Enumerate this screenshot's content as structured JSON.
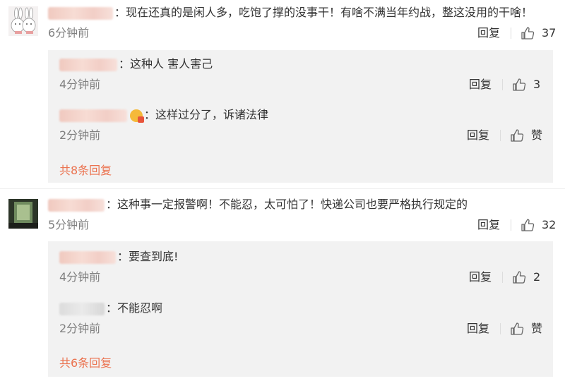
{
  "comments": [
    {
      "text": "现在还真的是闲人多，吃饱了撑的没事干！有啥不满当年约战，整这没用的干啥！",
      "time": "6分钟前",
      "reply_label": "回复",
      "like_count": "37",
      "replies": [
        {
          "text": "这种人 害人害己",
          "time": "4分钟前",
          "reply_label": "回复",
          "like_count": "3"
        },
        {
          "text": "这样过分了，诉诸法律",
          "time": "2分钟前",
          "reply_label": "回复",
          "like_count": "赞"
        }
      ],
      "more_replies": "共8条回复"
    },
    {
      "text": "这种事一定报警啊！不能忍，太可怕了！快递公司也要严格执行规定的",
      "time": "5分钟前",
      "reply_label": "回复",
      "like_count": "32",
      "replies": [
        {
          "text": "要查到底!",
          "time": "4分钟前",
          "reply_label": "回复",
          "like_count": "2"
        },
        {
          "text": "不能忍啊",
          "time": "2分钟前",
          "reply_label": "回复",
          "like_count": "赞"
        }
      ],
      "more_replies": "共6条回复"
    }
  ],
  "colon": "：",
  "icons": {
    "like": "thumbs-up-icon",
    "badge": "emoji-badge-icon"
  },
  "colors": {
    "link": "#eb7350",
    "reply_bg": "#f2f2f2",
    "time": "#808080"
  }
}
